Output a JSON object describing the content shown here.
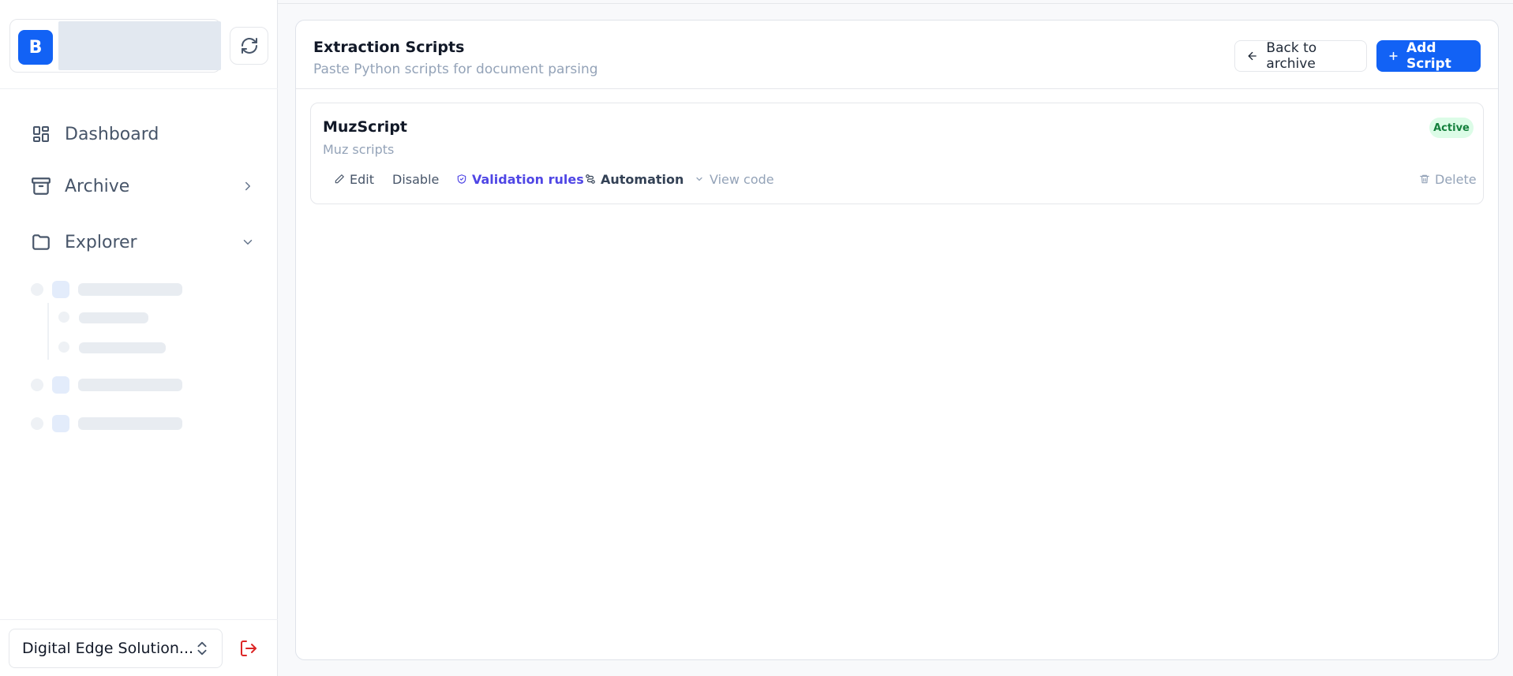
{
  "brand": {
    "logo_letter": "B"
  },
  "nav": {
    "items": [
      {
        "label": "Dashboard"
      },
      {
        "label": "Archive"
      },
      {
        "label": "Explorer"
      }
    ]
  },
  "org": {
    "selected": "Digital Edge Solution..."
  },
  "page": {
    "title": "Extraction Scripts",
    "subtitle": "Paste Python scripts for document parsing",
    "back_label": "Back to archive",
    "add_label": "Add Script"
  },
  "scripts": [
    {
      "name": "MuzScript",
      "description": "Muz scripts",
      "status": "Active",
      "actions": {
        "edit": "Edit",
        "disable": "Disable",
        "validation": "Validation rules",
        "automation": "Automation",
        "view_code": "View code",
        "delete": "Delete"
      }
    }
  ],
  "colors": {
    "accent": "#1262f5",
    "active_badge_bg": "#dcfce7",
    "active_badge_text": "#15803d",
    "validation_link": "#4f46e5",
    "logout": "#dc2626"
  }
}
